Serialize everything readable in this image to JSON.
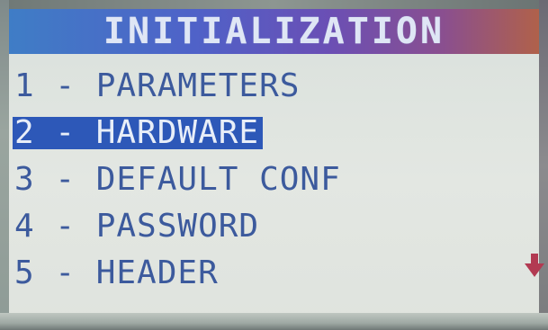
{
  "screen": {
    "title": "INITIALIZATION"
  },
  "menu": {
    "items": [
      {
        "label": "1 - PARAMETERS",
        "selected": false
      },
      {
        "label": "2 - HARDWARE",
        "selected": true
      },
      {
        "label": "3 - DEFAULT CONF",
        "selected": false
      },
      {
        "label": "4 - PASSWORD",
        "selected": false
      },
      {
        "label": "5 - HEADER",
        "selected": false
      }
    ]
  },
  "colors": {
    "title_gradient_start": "#3f7dc6",
    "title_gradient_end": "#b0614a",
    "text": "#3c5a9d",
    "selection": "#2d58b8",
    "scroll_arrow": "#b23a52"
  },
  "icons": {
    "scroll_indicator": "arrow-down-icon"
  }
}
